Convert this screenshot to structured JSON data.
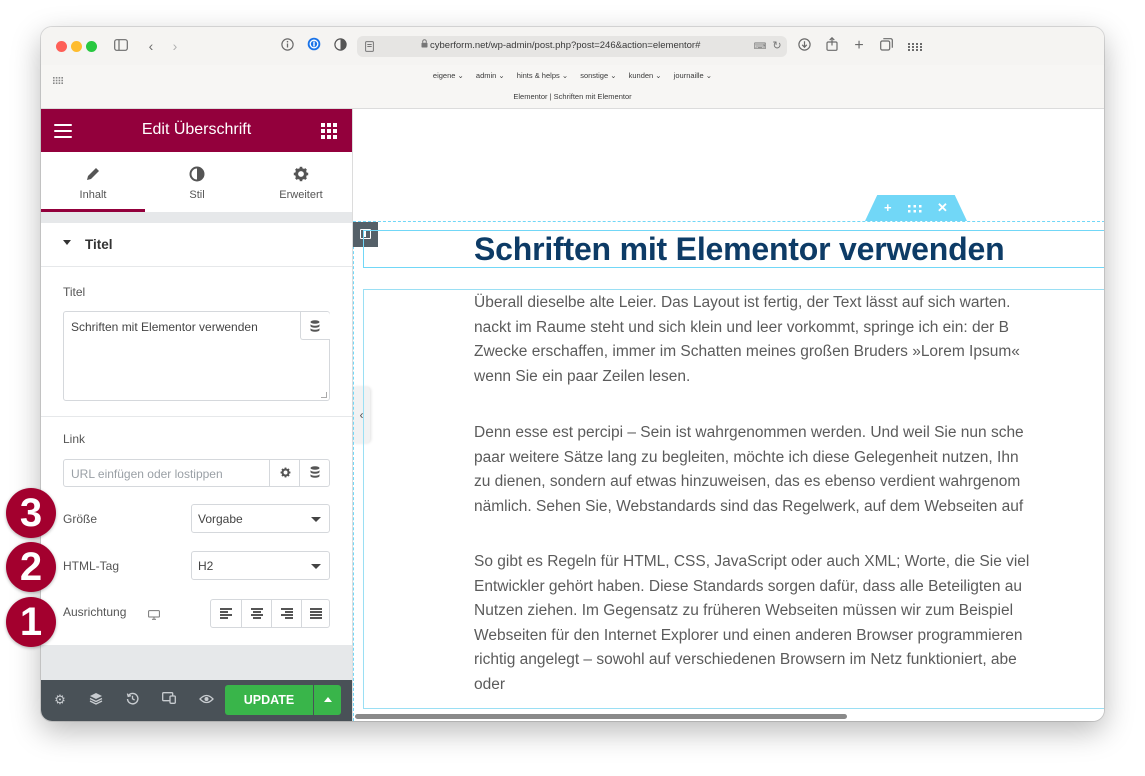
{
  "browser": {
    "url": "cyberform.net/wp-admin/post.php?post=246&action=elementor#",
    "bookmarks": [
      "eigene ⌄",
      "admin ⌄",
      "hints & helps ⌄",
      "sonstige ⌄",
      "kunden ⌄",
      "journaille ⌄"
    ],
    "page_title": "Elementor | Schriften mit Elementor"
  },
  "panel": {
    "title": "Edit Überschrift",
    "tabs": [
      {
        "label": "Inhalt",
        "icon": "pencil-icon"
      },
      {
        "label": "Stil",
        "icon": "contrast-icon"
      },
      {
        "label": "Erweitert",
        "icon": "gear-icon"
      }
    ],
    "section_title": "Titel",
    "title_field_label": "Titel",
    "title_value": "Schriften mit Elementor verwenden",
    "link_label": "Link",
    "link_placeholder": "URL einfügen oder lostippen",
    "size_label": "Größe",
    "size_value": "Vorgabe",
    "html_tag_label": "HTML-Tag",
    "html_tag_value": "H2",
    "alignment_label": "Ausrichtung",
    "update_label": "UPDATE"
  },
  "canvas": {
    "heading": "Schriften mit Elementor verwenden",
    "paragraphs": [
      [
        "Überall dieselbe alte Leier. Das Layout ist fertig, der Text lässt auf sich warten.",
        "nackt im Raume steht und sich klein und leer vorkommt, springe ich ein: der B",
        "Zwecke erschaffen, immer im Schatten meines großen Bruders »Lorem Ipsum«",
        "wenn Sie ein paar Zeilen lesen."
      ],
      [
        "Denn esse est percipi – Sein ist wahrgenommen werden. Und weil Sie nun sche",
        "paar weitere Sätze lang zu begleiten, möchte ich diese Gelegenheit nutzen, Ihn",
        "zu dienen, sondern auf etwas hinzuweisen, das es ebenso verdient wahrgenom",
        "nämlich. Sehen Sie, Webstandards sind das Regelwerk, auf dem Webseiten auf"
      ],
      [
        "So gibt es Regeln für HTML, CSS, JavaScript oder auch XML; Worte, die Sie viel",
        "Entwickler gehört haben. Diese Standards sorgen dafür, dass alle Beteiligten au",
        "Nutzen ziehen. Im Gegensatz zu früheren Webseiten müssen wir zum Beispiel",
        "Webseiten für den Internet Explorer und einen anderen Browser programmieren",
        "richtig angelegt – sowohl auf verschiedenen Browsern im Netz funktioniert, abe",
        "oder"
      ]
    ]
  },
  "annotations": {
    "badge_3": "3",
    "badge_2": "2",
    "badge_1": "1"
  },
  "colors": {
    "panel_header": "#93003c",
    "update_button": "#39b54a",
    "heading_text": "#0d3b66",
    "selection_outline": "#71d7f7",
    "badge": "#a3002e"
  }
}
